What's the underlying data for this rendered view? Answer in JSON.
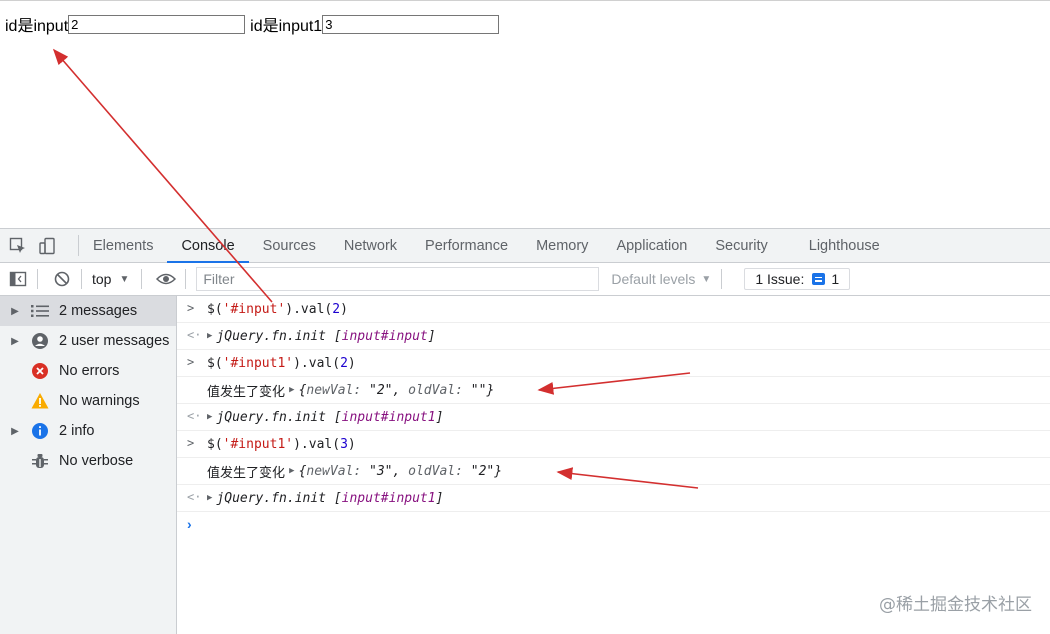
{
  "page": {
    "label1": "id是input",
    "input1_value": "2",
    "label2": "id是input1",
    "input2_value": "3"
  },
  "tabs": [
    "Elements",
    "Console",
    "Sources",
    "Network",
    "Performance",
    "Memory",
    "Application",
    "Security",
    "Lighthouse"
  ],
  "active_tab": "Console",
  "toolbar": {
    "context": "top",
    "filter_placeholder": "Filter",
    "levels": "Default levels",
    "issues_label": "1 Issue:",
    "issues_count": "1"
  },
  "sidebar": [
    {
      "label": "2 messages",
      "icon": "list-icon",
      "expandable": true
    },
    {
      "label": "2 user messages",
      "icon": "user-icon",
      "expandable": true
    },
    {
      "label": "No errors",
      "icon": "error-icon",
      "expandable": false
    },
    {
      "label": "No warnings",
      "icon": "warning-icon",
      "expandable": false
    },
    {
      "label": "2 info",
      "icon": "info-icon",
      "expandable": true
    },
    {
      "label": "No verbose",
      "icon": "bug-icon",
      "expandable": false
    }
  ],
  "console": {
    "cmd1": {
      "pre": "$(",
      "sel": "'#input'",
      "post": ").val(",
      "arg": "2",
      "close": ")"
    },
    "ret1": {
      "fn": "jQuery.fn.init [",
      "tag": "input#input",
      "close": "]"
    },
    "cmd2": {
      "pre": "$(",
      "sel": "'#input1'",
      "post": ").val(",
      "arg": "2",
      "close": ")"
    },
    "log2": {
      "text": "值发生了变化 ",
      "open": "{",
      "k1": "newVal: ",
      "v1": "\"2\"",
      "sep": ", ",
      "k2": "oldVal: ",
      "v2": "\"\"",
      "close": "}"
    },
    "ret2": {
      "fn": "jQuery.fn.init [",
      "tag": "input#input1",
      "close": "]"
    },
    "cmd3": {
      "pre": "$(",
      "sel": "'#input1'",
      "post": ").val(",
      "arg": "3",
      "close": ")"
    },
    "log3": {
      "text": "值发生了变化 ",
      "open": "{",
      "k1": "newVal: ",
      "v1": "\"3\"",
      "sep": ", ",
      "k2": "oldVal: ",
      "v2": "\"2\"",
      "close": "}"
    },
    "ret3": {
      "fn": "jQuery.fn.init [",
      "tag": "input#input1",
      "close": "]"
    }
  },
  "watermark": "@稀土掘金技术社区",
  "colors": {
    "annotation": "#d32f2f",
    "accent": "#1a73e8"
  }
}
